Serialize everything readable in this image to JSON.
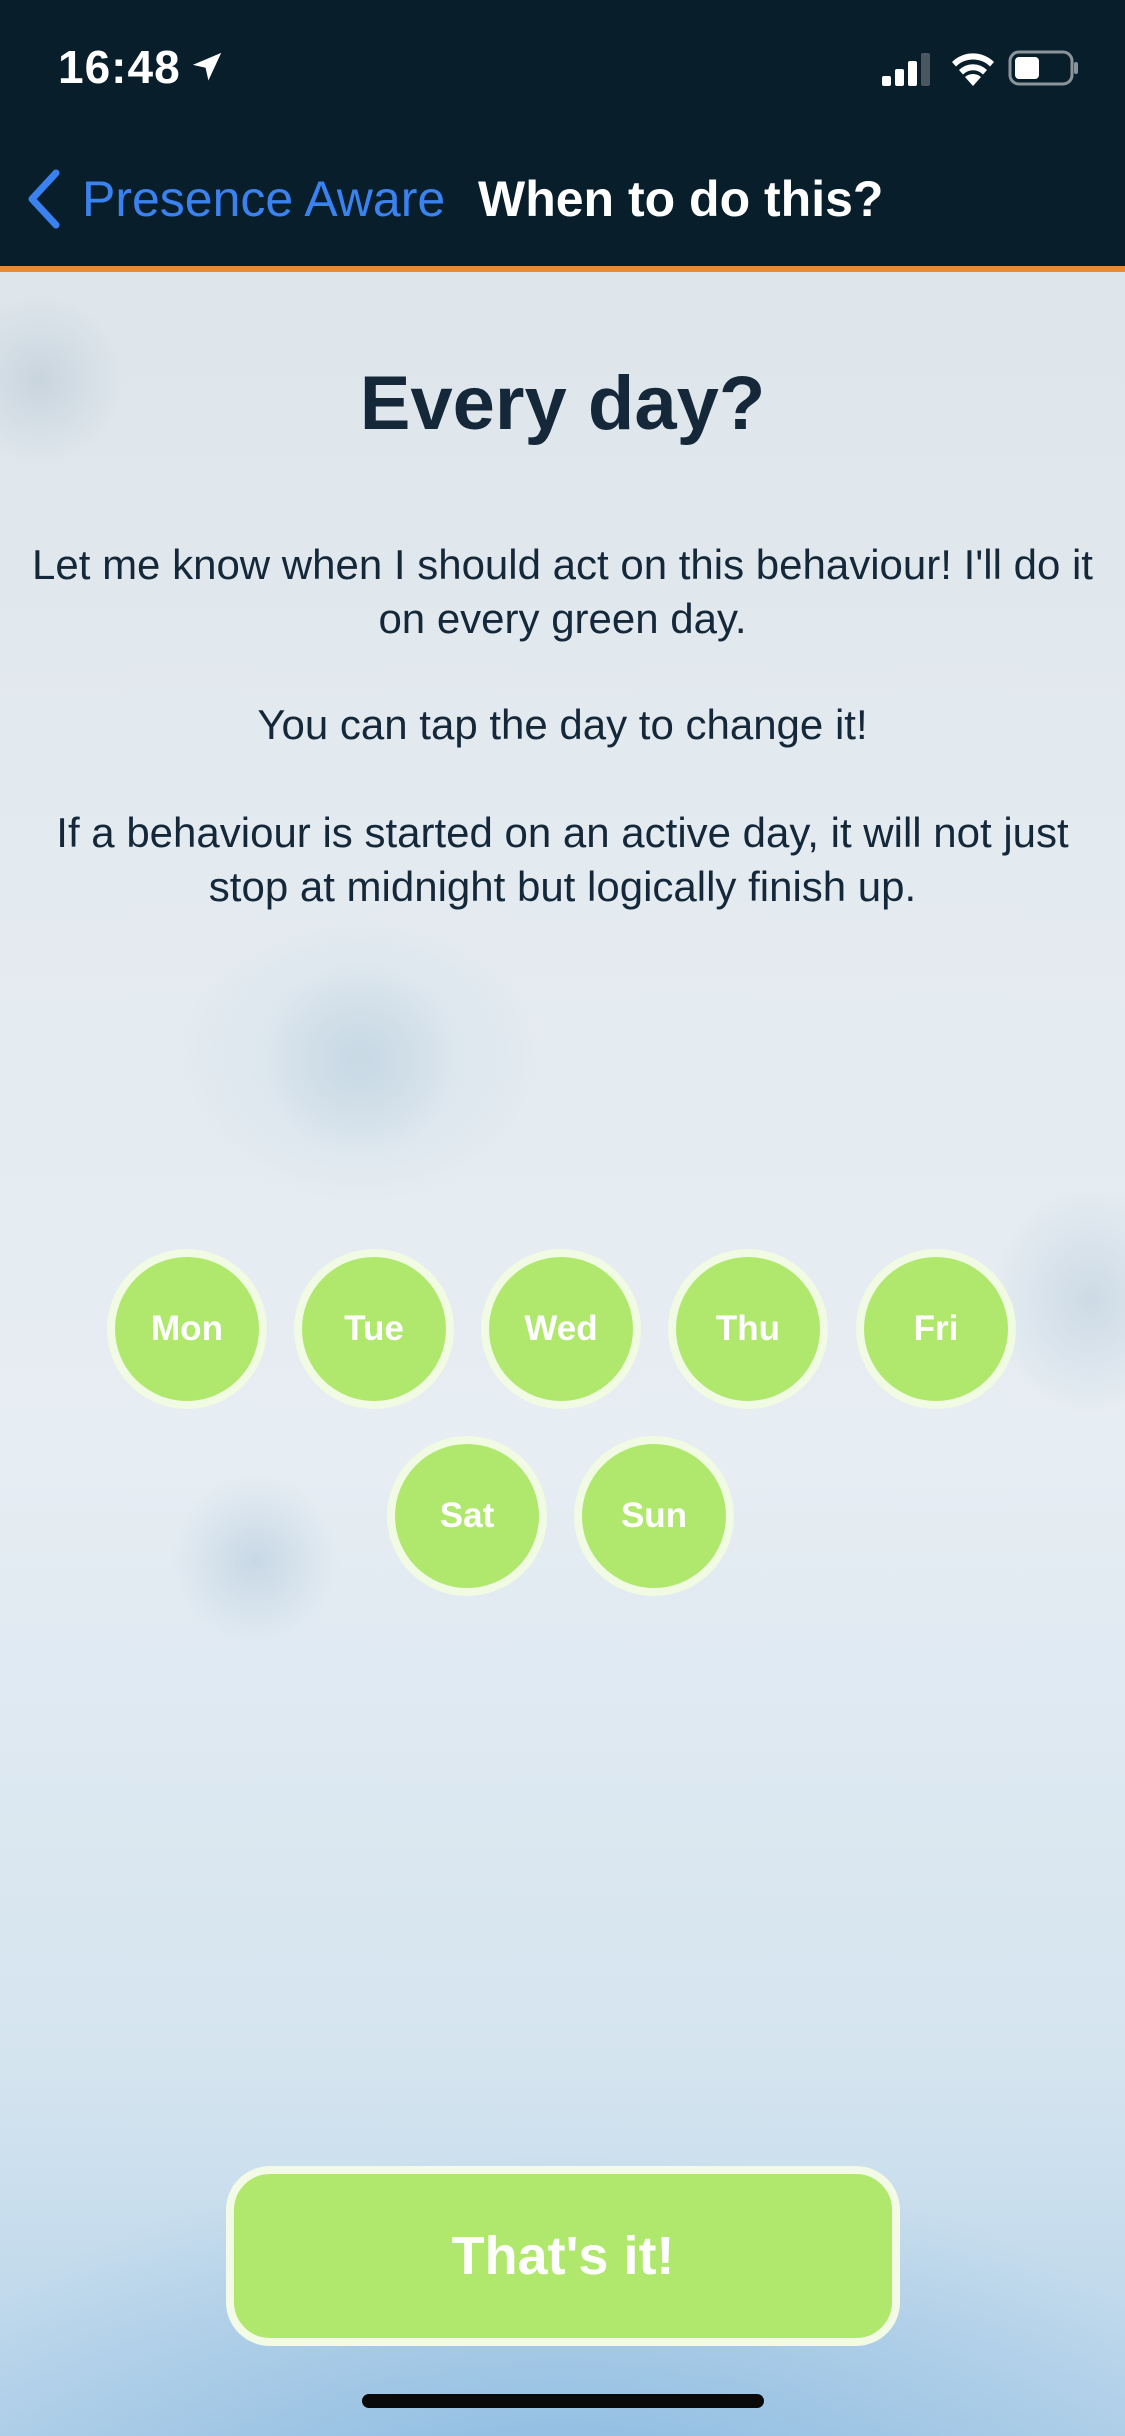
{
  "status_bar": {
    "time": "16:48",
    "icons": [
      "location-arrow-icon",
      "cellular-signal-icon",
      "wifi-icon",
      "battery-icon"
    ]
  },
  "nav": {
    "back_label": "Presence Aware",
    "title": "When to do this?"
  },
  "content": {
    "heading": "Every day?",
    "paragraph_1": "Let me know when I should act on this behaviour! I'll do it on every green day.",
    "paragraph_2": "You can tap the day to change it!",
    "paragraph_3": "If a behaviour is started on an active day, it will not just stop at midnight but logically finish up."
  },
  "days": {
    "mon": {
      "label": "Mon",
      "active": true
    },
    "tue": {
      "label": "Tue",
      "active": true
    },
    "wed": {
      "label": "Wed",
      "active": true
    },
    "thu": {
      "label": "Thu",
      "active": true
    },
    "fri": {
      "label": "Fri",
      "active": true
    },
    "sat": {
      "label": "Sat",
      "active": true
    },
    "sun": {
      "label": "Sun",
      "active": true
    }
  },
  "confirm_button_label": "That's it!",
  "colors": {
    "header_bg": "#081f2b",
    "accent_line": "#e88a3c",
    "link_blue": "#3a82f0",
    "active_day": "#b0e86e",
    "text_dark": "#14283a"
  }
}
